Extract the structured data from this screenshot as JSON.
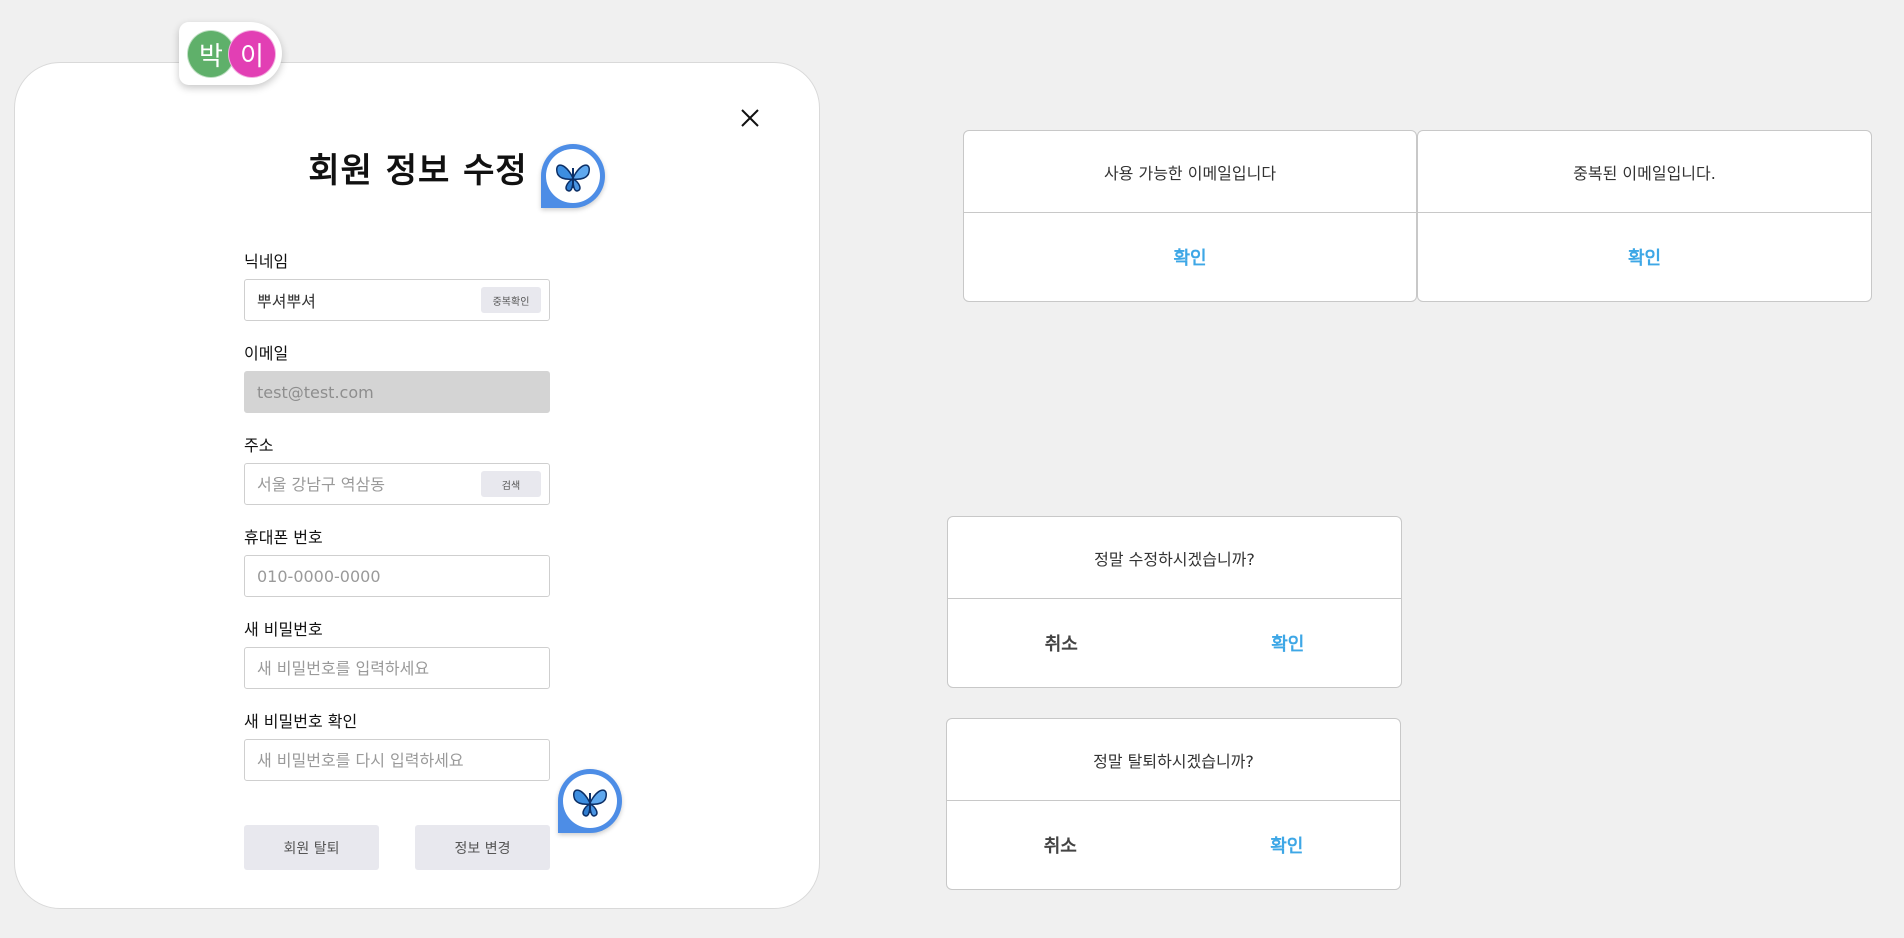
{
  "avatars": [
    "박",
    "이"
  ],
  "modal": {
    "title": "회원 정보 수정",
    "close_label": "X",
    "fields": {
      "nickname": {
        "label": "닉네임",
        "value": "뿌셔뿌셔",
        "button": "중복확인"
      },
      "email": {
        "label": "이메일",
        "placeholder": "test@test.com"
      },
      "address": {
        "label": "주소",
        "placeholder": "서울 강남구 역삼동",
        "button": "검색"
      },
      "phone": {
        "label": "휴대폰 번호",
        "placeholder": "010-0000-0000"
      },
      "new_password": {
        "label": "새 비밀번호",
        "placeholder": "새 비밀번호를 입력하세요"
      },
      "confirm_password": {
        "label": "새 비밀번호 확인",
        "placeholder": "새 비밀번호를 다시 입력하세요"
      }
    },
    "withdraw_label": "회원 탈퇴",
    "submit_label": "정보 변경"
  },
  "dialogs": {
    "email_available": {
      "message": "사용 가능한 이메일입니다",
      "ok": "확인"
    },
    "email_duplicate": {
      "message": "중복된 이메일입니다.",
      "ok": "확인"
    },
    "confirm_edit": {
      "message": "정말 수정하시겠습니까?",
      "cancel": "취소",
      "ok": "확인"
    },
    "confirm_withdraw": {
      "message": "정말 탈퇴하시겠습니까?",
      "cancel": "취소",
      "ok": "확인"
    }
  },
  "icons": {
    "close": "close-icon",
    "badge": "butterfly-icon"
  },
  "colors": {
    "accent": "#3ea7e6",
    "badge": "#4d8de6",
    "avatar1": "#5fb06a",
    "avatar2": "#e23fb4"
  }
}
